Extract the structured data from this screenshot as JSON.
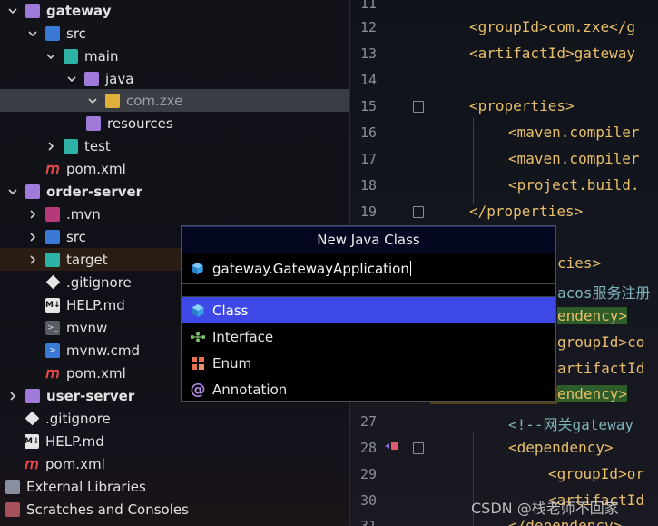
{
  "tree": {
    "items": [
      {
        "label": "gateway",
        "bold": true,
        "expanded": true,
        "icon": "module-folder-icon"
      },
      {
        "label": "src",
        "expanded": true,
        "icon": "source-folder-icon"
      },
      {
        "label": "main",
        "expanded": true,
        "icon": "folder-icon"
      },
      {
        "label": "java",
        "expanded": true,
        "icon": "source-root-icon"
      },
      {
        "label": "com.zxe",
        "expanded": true,
        "icon": "package-icon",
        "selected": true
      },
      {
        "label": "resources",
        "icon": "resources-folder-icon"
      },
      {
        "label": "test",
        "expanded": false,
        "icon": "test-folder-icon"
      },
      {
        "label": "pom.xml",
        "icon": "maven-icon"
      },
      {
        "label": "order-server",
        "bold": true,
        "expanded": true,
        "icon": "module-folder-icon"
      },
      {
        "label": ".mvn",
        "expanded": false,
        "icon": "folder-icon"
      },
      {
        "label": "src",
        "expanded": false,
        "icon": "source-folder-icon"
      },
      {
        "label": "target",
        "expanded": false,
        "icon": "excluded-folder-icon"
      },
      {
        "label": ".gitignore",
        "icon": "git-icon"
      },
      {
        "label": "HELP.md",
        "icon": "markdown-icon"
      },
      {
        "label": "mvnw",
        "icon": "shell-icon"
      },
      {
        "label": "mvnw.cmd",
        "icon": "cmd-icon"
      },
      {
        "label": "pom.xml",
        "icon": "maven-icon"
      },
      {
        "label": "user-server",
        "bold": true,
        "expanded": false,
        "icon": "module-folder-icon"
      },
      {
        "label": ".gitignore",
        "icon": "git-icon"
      },
      {
        "label": "HELP.md",
        "icon": "markdown-icon"
      },
      {
        "label": "pom.xml",
        "icon": "maven-icon"
      },
      {
        "label": "External Libraries",
        "expanded": false,
        "icon": "libraries-icon"
      },
      {
        "label": "Scratches and Consoles",
        "expanded": false,
        "icon": "scratches-icon"
      }
    ]
  },
  "editor": {
    "lines": [
      {
        "num": "11",
        "text": ""
      },
      {
        "num": "12",
        "text": "<groupId>com.zxe</g"
      },
      {
        "num": "13",
        "text": "<artifactId>gateway"
      },
      {
        "num": "14",
        "text": ""
      },
      {
        "num": "15",
        "text": "<properties>"
      },
      {
        "num": "16",
        "text": "<maven.compiler"
      },
      {
        "num": "17",
        "text": "<maven.compiler"
      },
      {
        "num": "18",
        "text": "<project.build."
      },
      {
        "num": "19",
        "text": "</properties>"
      },
      {
        "num": "27",
        "text": "<!--网关gateway"
      },
      {
        "num": "28",
        "text": "<dependency>"
      },
      {
        "num": "29",
        "text": "<groupId>or"
      },
      {
        "num": "30",
        "text": "<artifactId"
      },
      {
        "num": "31",
        "text": "</dependency>"
      }
    ],
    "behind_dialog": [
      "cies>",
      "acos服务注册",
      "endency>",
      "groupId>co",
      "artifactId",
      "endency>"
    ]
  },
  "dialog": {
    "title": "New Java Class",
    "input_value": "gateway.GatewayApplication",
    "options": [
      {
        "label": "Class",
        "icon": "class-icon",
        "selected": true
      },
      {
        "label": "Interface",
        "icon": "interface-icon"
      },
      {
        "label": "Enum",
        "icon": "enum-icon"
      },
      {
        "label": "Annotation",
        "icon": "annotation-icon"
      }
    ]
  },
  "watermark": "CSDN @栈老师不回家",
  "colors": {
    "accent": "#3d48e6",
    "tag": "#e8bf6a",
    "title_border": "#1e2c7a"
  }
}
